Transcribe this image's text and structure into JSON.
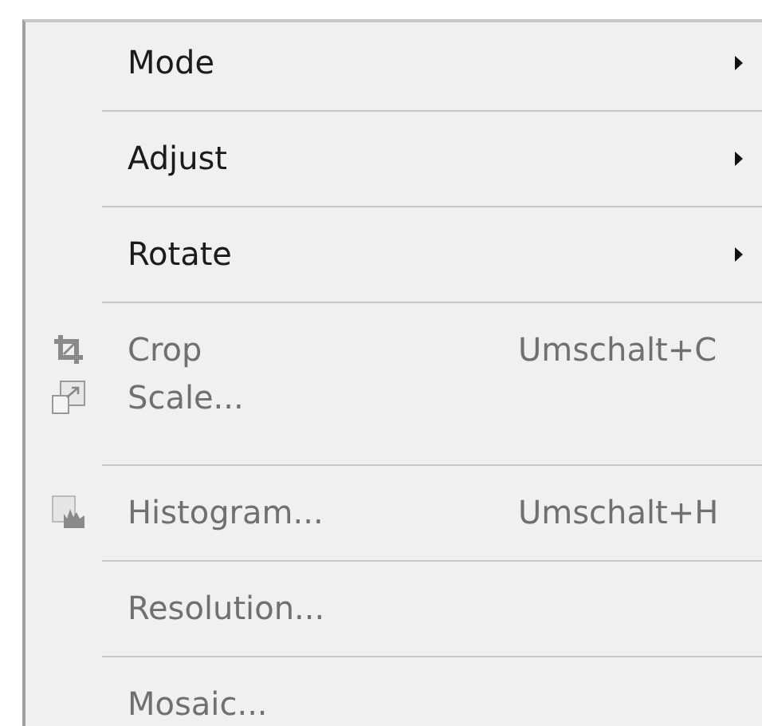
{
  "menu": [
    {
      "kind": "item",
      "label": "Mode",
      "disabled": false,
      "submenu": true
    },
    {
      "kind": "separator"
    },
    {
      "kind": "item",
      "label": "Adjust",
      "disabled": false,
      "submenu": true
    },
    {
      "kind": "separator"
    },
    {
      "kind": "item",
      "label": "Rotate",
      "disabled": false,
      "submenu": true
    },
    {
      "kind": "separator"
    },
    {
      "kind": "item",
      "label": "Crop",
      "disabled": true,
      "shortcut": "Umschalt+C"
    },
    {
      "kind": "item",
      "label": "Scale...",
      "disabled": true
    },
    {
      "kind": "separator"
    },
    {
      "kind": "item",
      "label": "Histogram...",
      "disabled": true,
      "shortcut": "Umschalt+H"
    },
    {
      "kind": "separator"
    },
    {
      "kind": "item",
      "label": "Resolution...",
      "disabled": true
    },
    {
      "kind": "separator"
    },
    {
      "kind": "item",
      "label": "Mosaic...",
      "disabled": true
    }
  ]
}
